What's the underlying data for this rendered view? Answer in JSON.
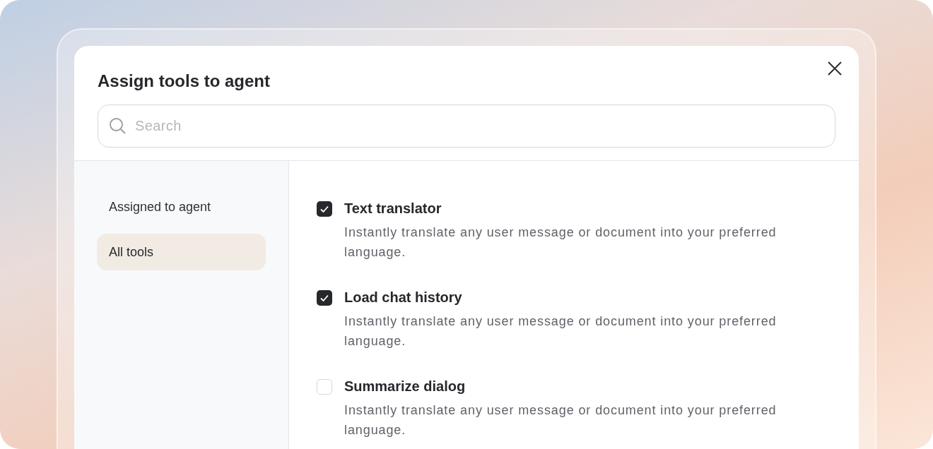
{
  "dialog": {
    "title": "Assign tools to agent",
    "search": {
      "placeholder": "Search"
    }
  },
  "sidebar": {
    "items": [
      {
        "label": "Assigned to agent",
        "selected": false
      },
      {
        "label": "All tools",
        "selected": true
      }
    ]
  },
  "tools": [
    {
      "name": "Text translator",
      "description": "Instantly translate any user message or document into your preferred language.",
      "checked": true
    },
    {
      "name": "Load chat history",
      "description": "Instantly translate any user message or document into your preferred language.",
      "checked": true
    },
    {
      "name": "Summarize dialog",
      "description": "Instantly translate any user message or document into your preferred language.",
      "checked": false
    }
  ]
}
